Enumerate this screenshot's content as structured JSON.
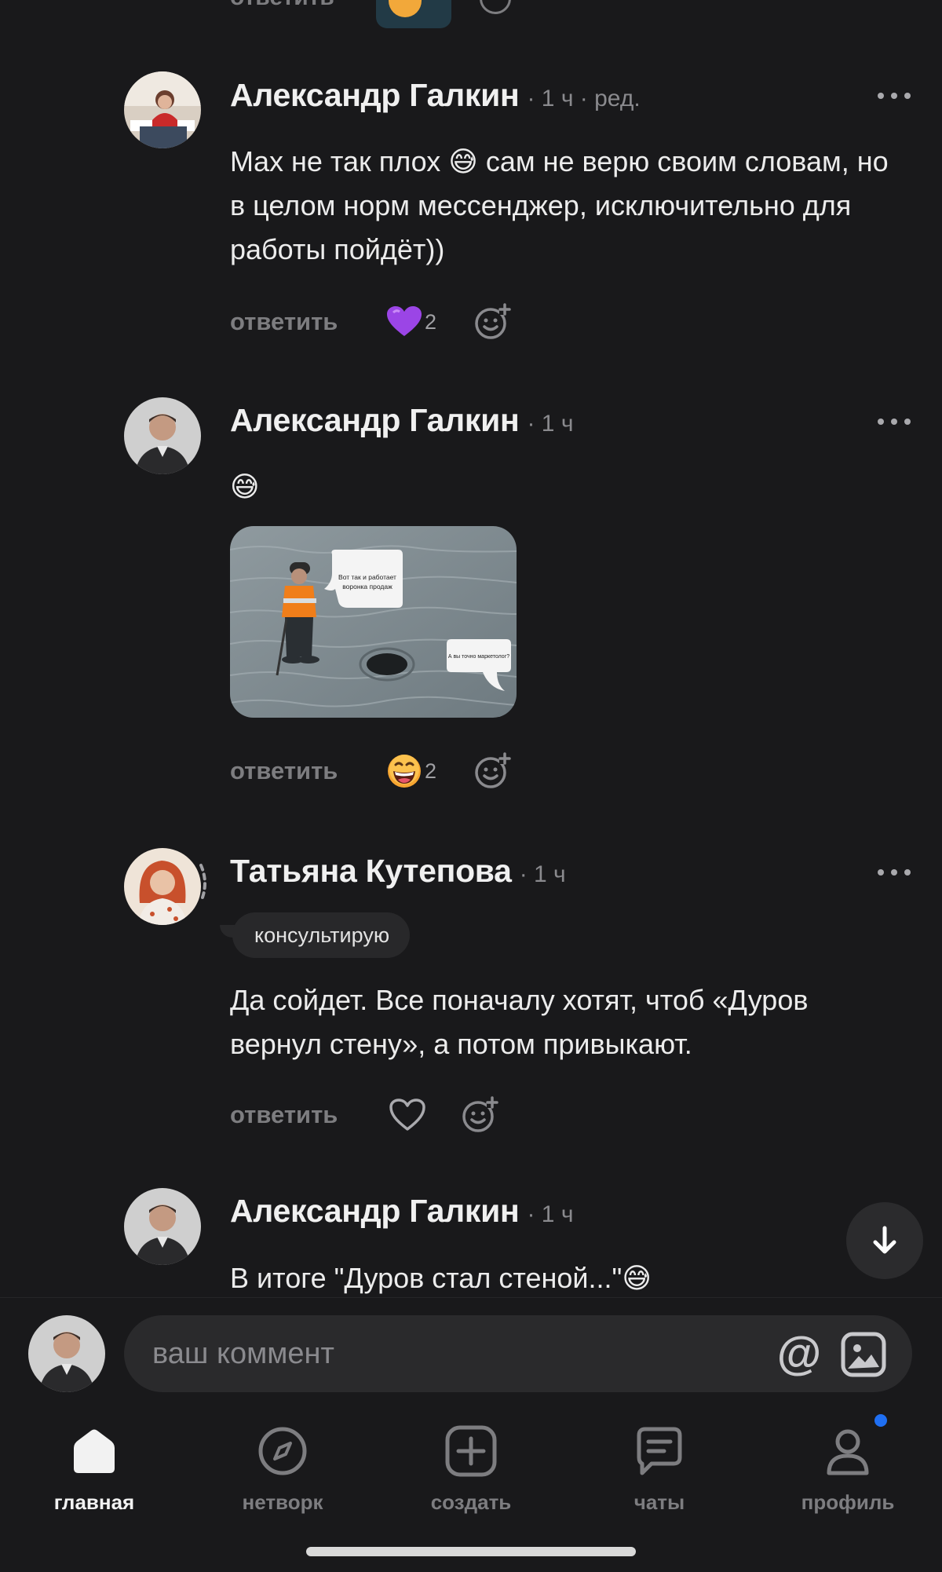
{
  "top_partial": {
    "reply_label": "ответить"
  },
  "comments": [
    {
      "author": "Александр Галкин",
      "time": "· 1 ч · ред.",
      "text": "Max не так плох 😅 сам не верю своим словам, но в целом норм мессенджер, исключительно для работы пойдёт))",
      "reply_label": "ответить",
      "reaction_emoji": "💜",
      "reaction_count": "2"
    },
    {
      "author": "Александр Галкин",
      "time": "· 1 ч",
      "text": "😅",
      "meme_bubble_1": "Вот так и работает воронка продаж",
      "meme_bubble_2": "А вы точно маркетолог?",
      "reply_label": "ответить",
      "reaction_emoji": "😄",
      "reaction_count": "2"
    },
    {
      "author": "Татьяна Кутепова",
      "time": "· 1 ч",
      "badge": "консультирую",
      "text": "Да сойдет. Все поначалу хотят, чтоб «Дуров вернул стену», а потом привыкают.",
      "reply_label": "ответить"
    },
    {
      "author": "Александр Галкин",
      "time": "· 1 ч",
      "text": "В итоге \"Дуров стал стеной...\"😅"
    }
  ],
  "composer": {
    "placeholder": "ваш коммент",
    "mention_symbol": "@"
  },
  "tabs": [
    {
      "label": "главная",
      "icon": "home-icon",
      "active": true
    },
    {
      "label": "нетворк",
      "icon": "compass-icon",
      "active": false
    },
    {
      "label": "создать",
      "icon": "plus-square-icon",
      "active": false
    },
    {
      "label": "чаты",
      "icon": "chat-icon",
      "active": false
    },
    {
      "label": "профиль",
      "icon": "profile-icon",
      "active": false,
      "notification": true
    }
  ],
  "colors": {
    "background": "#19191b",
    "notification": "#1f6ff2",
    "muted": "#7d7d80"
  }
}
